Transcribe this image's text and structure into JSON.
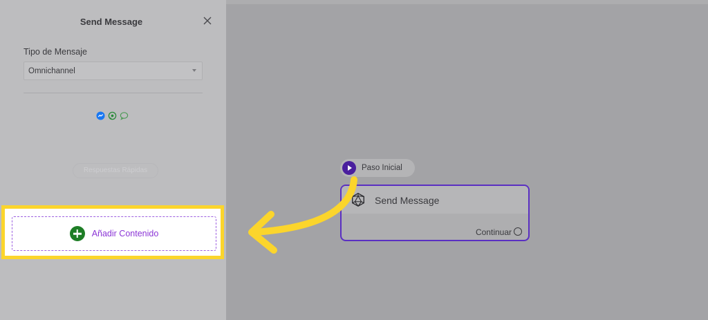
{
  "panel": {
    "title": "Send Message",
    "message_type_label": "Tipo de Mensaje",
    "message_type_value": "Omnichannel",
    "channels": [
      "messenger-icon",
      "whatsapp-icon",
      "chat-icon"
    ],
    "ghost_button_label": "Respuestas Rápidas",
    "add_content_label": "Añadir Contenido"
  },
  "canvas": {
    "start_node_label": "Paso Inicial",
    "message_node_title": "Send Message",
    "continue_label": "Continuar"
  },
  "colors": {
    "highlight": "#fbd52c",
    "accent_purple": "#8b35d6",
    "add_icon_green": "#1e7e26",
    "node_border": "#5a2fc2"
  }
}
